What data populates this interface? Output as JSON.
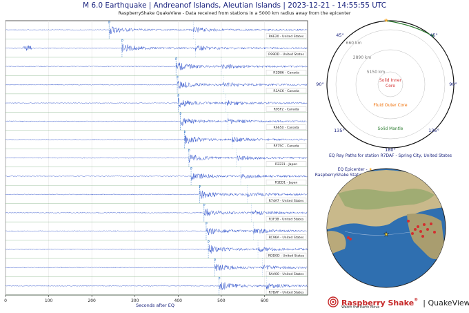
{
  "header": {
    "title": "M 6.0 Earthquake | Andreanof Islands, Aleutian Islands | 2023-12-21 - 14:55:55 UTC",
    "subtitle": "RaspberryShake QuakeView - Data received from stations in a 5000 km radius away from the epicenter"
  },
  "chart_data": [
    {
      "type": "line",
      "title": "",
      "xlabel": "Seconds after EQ",
      "ylabel": "",
      "xlim": [
        0,
        700
      ],
      "xticks": [
        0,
        100,
        200,
        300,
        400,
        500,
        600
      ],
      "grid": true,
      "series": [
        {
          "name": "R6E20 - United States",
          "p_arrival": 240,
          "s_arrival": 435
        },
        {
          "name": "R99DD - United States",
          "p_arrival": 270,
          "s_arrival": 440
        },
        {
          "name": "R1D86 - Canada",
          "p_arrival": 395,
          "s_arrival": 500
        },
        {
          "name": "R1AC6 - Canada",
          "p_arrival": 398,
          "s_arrival": 505
        },
        {
          "name": "R95F2 - Canada",
          "p_arrival": 400,
          "s_arrival": 510
        },
        {
          "name": "R6650 - Canada",
          "p_arrival": 405,
          "s_arrival": 515
        },
        {
          "name": "RF75C - Canada",
          "p_arrival": 415,
          "s_arrival": 525
        },
        {
          "name": "R2231 - Japan",
          "p_arrival": 425,
          "s_arrival": 535
        },
        {
          "name": "R1ED1 - Japan",
          "p_arrival": 430,
          "s_arrival": 545
        },
        {
          "name": "R74A7 - United States",
          "p_arrival": 450,
          "s_arrival": 560
        },
        {
          "name": "R3F3B - United States",
          "p_arrival": 460,
          "s_arrival": 570
        },
        {
          "name": "RC96A - United States",
          "p_arrival": 465,
          "s_arrival": 575
        },
        {
          "name": "RDD0D - United States",
          "p_arrival": 470,
          "s_arrival": 585
        },
        {
          "name": "RAA00 - United States",
          "p_arrival": 485,
          "s_arrival": 595
        },
        {
          "name": "R7DAF - United States",
          "p_arrival": 495,
          "s_arrival": 605
        }
      ]
    },
    {
      "type": "diagram",
      "title": "EQ Ray Paths for station R7DAF - Spring City, United States",
      "depth_labels": [
        "660 km",
        "2890 km",
        "5150 km"
      ],
      "layer_labels": [
        "Solid Inner Core",
        "Fluid Outer Core",
        "Solid Mantle"
      ],
      "angle_labels": [
        "45°",
        "45°",
        "90°",
        "90°",
        "135°",
        "135°",
        "180°"
      ]
    }
  ],
  "legend": {
    "epicenter": "EQ Epicenter -",
    "station": "RaspberryShake Station -"
  },
  "branding": {
    "name": "Raspberry Shake",
    "reg": "®",
    "product": "QuakeView",
    "tagline": "Watch the Earth Move"
  },
  "colors": {
    "trace": "#3355cc",
    "title": "#1a237e",
    "inner_core": "#d32f2f",
    "outer_core": "#ef6c00",
    "mantle": "#2e7d32",
    "brand": "#c62828"
  }
}
